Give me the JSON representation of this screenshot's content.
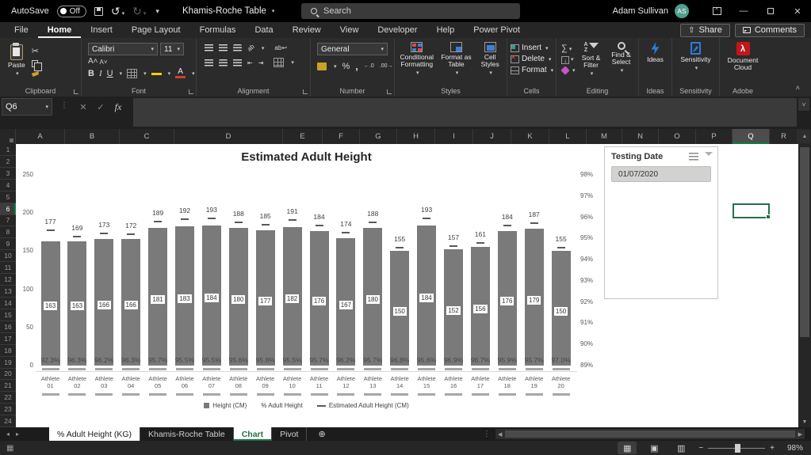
{
  "titlebar": {
    "autosave_label": "AutoSave",
    "autosave_state": "Off",
    "doc_title": "Khamis-Roche Table",
    "search_placeholder": "Search",
    "user_name": "Adam Sullivan",
    "user_initials": "AS"
  },
  "ribbon": {
    "tabs": [
      {
        "label": "File",
        "active": false
      },
      {
        "label": "Home",
        "active": true
      },
      {
        "label": "Insert",
        "active": false
      },
      {
        "label": "Page Layout",
        "active": false
      },
      {
        "label": "Formulas",
        "active": false
      },
      {
        "label": "Data",
        "active": false
      },
      {
        "label": "Review",
        "active": false
      },
      {
        "label": "View",
        "active": false
      },
      {
        "label": "Developer",
        "active": false
      },
      {
        "label": "Help",
        "active": false
      },
      {
        "label": "Power Pivot",
        "active": false
      }
    ],
    "share_label": "Share",
    "comments_label": "Comments",
    "font_name": "Calibri",
    "font_size": "11",
    "number_format": "General",
    "groups": {
      "clipboard": {
        "label": "Clipboard",
        "paste": "Paste"
      },
      "font": {
        "label": "Font"
      },
      "alignment": {
        "label": "Alignment"
      },
      "number": {
        "label": "Number"
      },
      "styles": {
        "label": "Styles",
        "conditional": "Conditional Formatting",
        "format_table": "Format as Table",
        "cell_styles": "Cell Styles"
      },
      "cells": {
        "label": "Cells",
        "insert": "Insert",
        "delete": "Delete",
        "format": "Format"
      },
      "editing": {
        "label": "Editing",
        "sort": "Sort & Filter",
        "find": "Find & Select"
      },
      "ideas": {
        "label": "Ideas",
        "button": "Ideas"
      },
      "sensitivity": {
        "label": "Sensitivity",
        "button": "Sensitivity"
      },
      "adobe": {
        "label": "Adobe",
        "button": "Document Cloud"
      }
    }
  },
  "formula_bar": {
    "name_box": "Q6",
    "fx_label": "fx"
  },
  "grid": {
    "columns": [
      "A",
      "B",
      "C",
      "D",
      "E",
      "F",
      "G",
      "H",
      "I",
      "J",
      "K",
      "L",
      "M",
      "N",
      "O",
      "P",
      "Q",
      "R"
    ],
    "selected_column": "Q",
    "rows": [
      1,
      2,
      3,
      4,
      5,
      6,
      7,
      8,
      9,
      10,
      11,
      12,
      13,
      14,
      15,
      16,
      17,
      18,
      19,
      20,
      21,
      22,
      23,
      24
    ],
    "selected_row": 6,
    "selected_cell": "Q6"
  },
  "chart_data": {
    "type": "bar",
    "title": "Estimated Adult Height",
    "categories": [
      "Athlete 01",
      "Athlete 02",
      "Athlete 03",
      "Athlete 04",
      "Athlete 05",
      "Athlete 06",
      "Athlete 07",
      "Athlete 08",
      "Athlete 09",
      "Athlete 10",
      "Athlete 11",
      "Athlete 12",
      "Athlete 13",
      "Athlete 14",
      "Athlete 15",
      "Athlete 16",
      "Athlete 17",
      "Athlete 18",
      "Athlete 19",
      "Athlete 20"
    ],
    "series": [
      {
        "name": "Height (CM)",
        "type": "bar",
        "axis": "primary",
        "values": [
          163,
          163,
          166,
          166,
          181,
          183,
          184,
          180,
          177,
          182,
          176,
          167,
          180,
          150,
          184,
          152,
          156,
          176,
          179,
          150
        ]
      },
      {
        "name": "% Adult Height",
        "type": "label",
        "axis": "secondary",
        "values": [
          92.3,
          96.3,
          96.2,
          96.3,
          95.7,
          95.5,
          95.5,
          95.6,
          95.8,
          95.5,
          95.7,
          96.2,
          95.7,
          96.8,
          95.6,
          96.9,
          96.7,
          95.9,
          95.7,
          97.0
        ]
      },
      {
        "name": "Estimated Adult Height (CM)",
        "type": "dash-marker",
        "axis": "primary",
        "values": [
          177,
          169,
          173,
          172,
          189,
          192,
          193,
          188,
          185,
          191,
          184,
          174,
          188,
          155,
          193,
          157,
          161,
          184,
          187,
          155
        ]
      }
    ],
    "primary_axis": {
      "min": 0,
      "max": 250,
      "ticks": [
        0,
        50,
        100,
        150,
        200,
        250
      ]
    },
    "secondary_axis": {
      "min": 89,
      "max": 98,
      "ticks": [
        89,
        90,
        91,
        92,
        93,
        94,
        95,
        96,
        97,
        98
      ],
      "suffix": "%"
    },
    "legend": [
      "Height (CM)",
      "% Adult Height",
      "Estimated Adult Height (CM)"
    ],
    "legend_position": "bottom",
    "bar_color": "#7a7a7a"
  },
  "slicer": {
    "title": "Testing Date",
    "items": [
      {
        "label": "01/07/2020",
        "selected": true
      }
    ]
  },
  "sheet_tabs": [
    {
      "label": "% Adult Height (KG)",
      "variant": "light"
    },
    {
      "label": "Khamis-Roche Table",
      "variant": "dark"
    },
    {
      "label": "Chart",
      "variant": "active"
    },
    {
      "label": "Pivot",
      "variant": "dark"
    }
  ],
  "status_bar": {
    "zoom_level": "98%"
  }
}
